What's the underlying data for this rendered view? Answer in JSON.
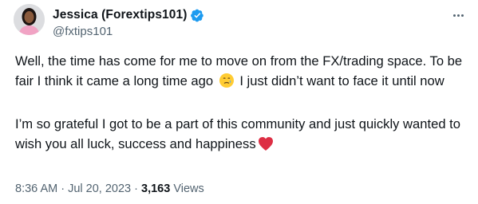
{
  "author": {
    "display_name": "Jessica (Forextips101)",
    "handle": "@fxtips101",
    "verified": true
  },
  "post": {
    "paragraph_1_a": "Well, the time has come for me to move on from the FX/trading space. To be fair I think it came a long time ago",
    "paragraph_1_b": "I just didn’t want to face it until now",
    "paragraph_2": "I’m so grateful I got to be a part of this community and just quickly wanted to wish you all luck, success and happiness",
    "emoji_1": "crying-face-emoji",
    "emoji_2": "red-heart-emoji"
  },
  "meta": {
    "time": "8:36 AM",
    "separator_1": " · ",
    "date": "Jul 20, 2023",
    "separator_2": " · ",
    "views_count": "3,163",
    "views_label": " Views"
  },
  "colors": {
    "text": "#0f1419",
    "secondary": "#536471",
    "verified_badge": "#1d9bf0",
    "heart": "#e0245e"
  },
  "icons": [
    "verified-badge-icon",
    "more-options-icon"
  ]
}
